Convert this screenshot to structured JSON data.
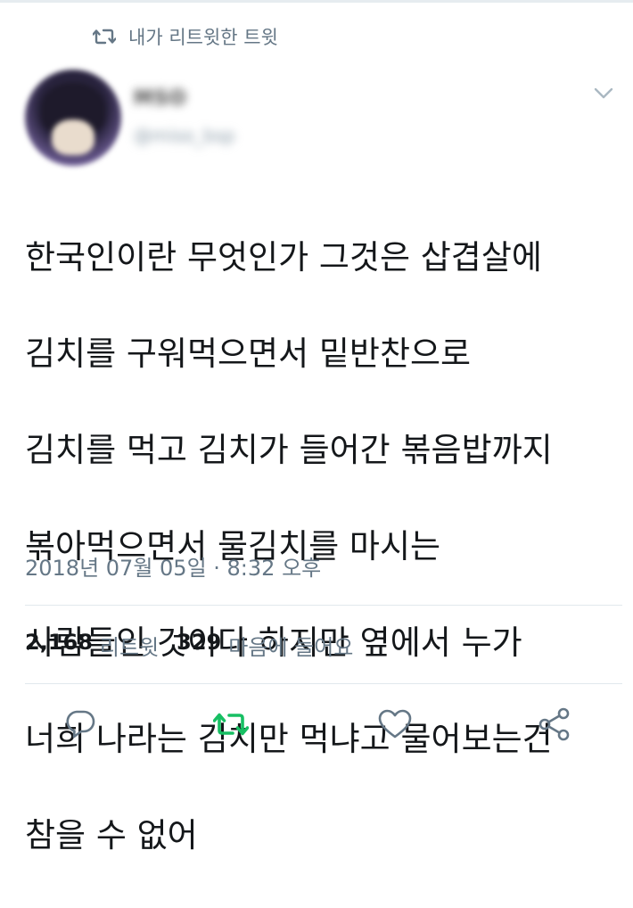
{
  "retweet_context": {
    "icon": "retweet-icon",
    "label": "내가 리트윗한 트윗"
  },
  "author": {
    "display_name": "MSO",
    "handle": "@miso_bsp",
    "avatar": "avatar-image",
    "blurred": true
  },
  "tweet": {
    "lines": [
      "한국인이란 무엇인가 그것은 삽겹살에",
      "김치를 구워먹으면서 밑반찬으로",
      "김치를 먹고 김치가 들어간 볶음밥까지",
      "볶아먹으면서 물김치를 마시는",
      "사람들인 것이다 하지만 옆에서 누가",
      "너희 나라는 김치만 먹냐고 물어보는건",
      "참을 수 없어"
    ],
    "timestamp": "2018년 07월 05일 · 8:32 오후"
  },
  "stats": {
    "retweets_count": "2,168",
    "retweets_label": "리트윗",
    "likes_count": "329",
    "likes_label": "마음에 들어요"
  },
  "actions": {
    "reply": "reply-icon",
    "retweet": "retweet-icon",
    "like": "heart-icon",
    "share": "share-icon"
  },
  "colors": {
    "retweet_active": "#17bf63",
    "secondary_text": "#657786",
    "divider": "#e1e8ed"
  }
}
